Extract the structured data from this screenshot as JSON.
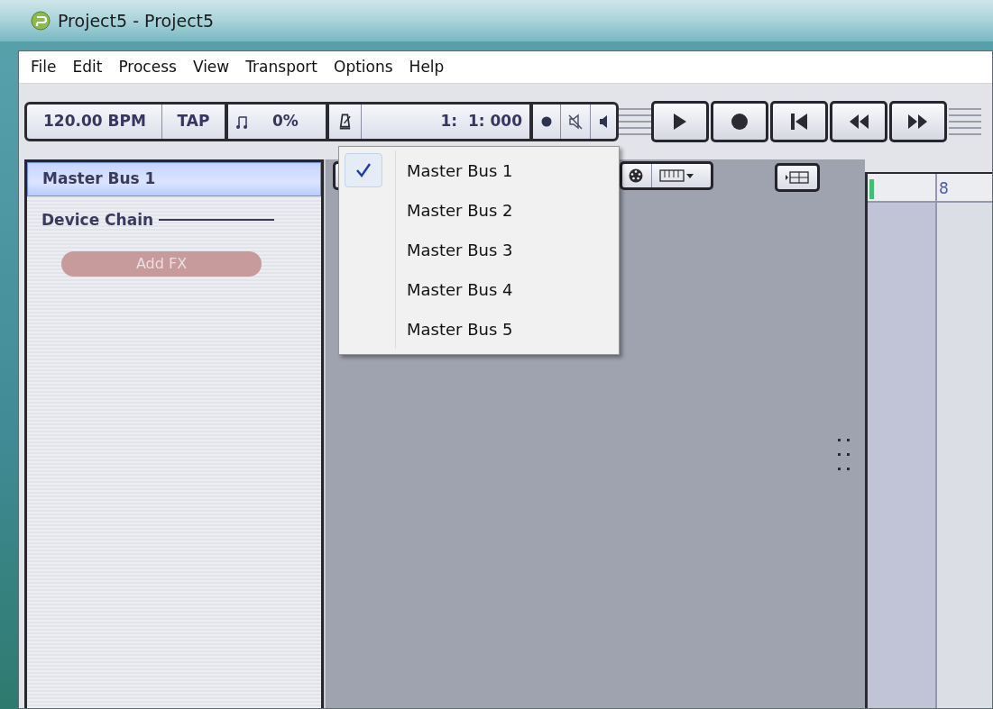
{
  "window": {
    "title": "Project5 - Project5"
  },
  "menu": [
    "File",
    "Edit",
    "Process",
    "View",
    "Transport",
    "Options",
    "Help"
  ],
  "toolbar": {
    "tempo": "120.00 BPM",
    "tap": "TAP",
    "swing": "0%",
    "position": "1:  1: 000"
  },
  "panel": {
    "title": "Master Bus 1",
    "section": "Device Chain",
    "add_button": {
      "label": "Add FX",
      "disabled": true
    }
  },
  "ruler": {
    "bar_label": "8"
  },
  "bus_menu": {
    "items": [
      {
        "label": "Master Bus 1",
        "checked": true
      },
      {
        "label": "Master Bus 2",
        "checked": false
      },
      {
        "label": "Master Bus 3",
        "checked": false
      },
      {
        "label": "Master Bus 4",
        "checked": false
      },
      {
        "label": "Master Bus 5",
        "checked": false
      }
    ]
  }
}
